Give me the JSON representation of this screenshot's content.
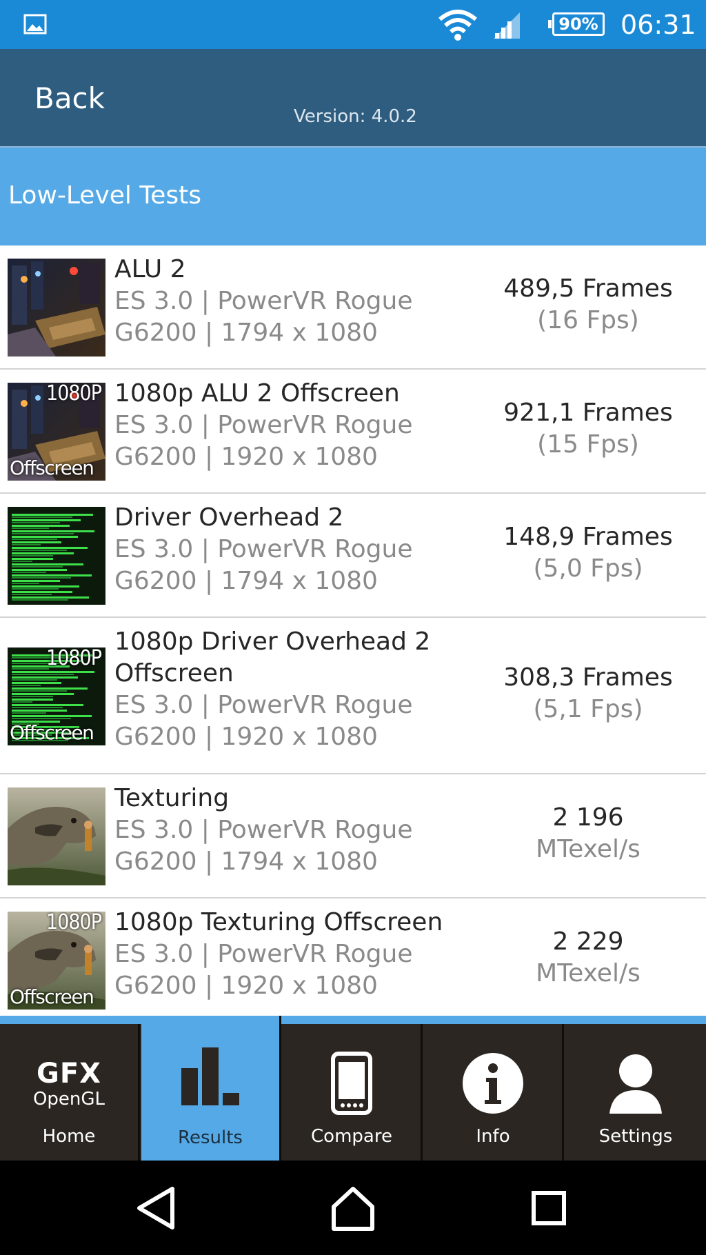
{
  "status_bar": {
    "battery": "90%",
    "time": "06:31",
    "icons": [
      "gallery-icon",
      "wifi-icon",
      "signal-icon",
      "battery-icon"
    ]
  },
  "header": {
    "back_label": "Back",
    "version": "Version: 4.0.2"
  },
  "section": {
    "title": "Low-Level Tests"
  },
  "results": [
    {
      "title": [
        "ALU 2"
      ],
      "subtitle": [
        "ES 3.0 | PowerVR Rogue",
        "G6200 | 1794 x 1080"
      ],
      "result_main": "489,5 Frames",
      "result_secondary": "(16 Fps)",
      "thumb": "alu-scene",
      "thumb_top": "",
      "thumb_bottom": ""
    },
    {
      "title": [
        "1080p ALU 2 Offscreen"
      ],
      "subtitle": [
        "ES 3.0 | PowerVR Rogue",
        "G6200 | 1920 x 1080"
      ],
      "result_main": "921,1 Frames",
      "result_secondary": "(15 Fps)",
      "thumb": "alu-scene",
      "thumb_top": "1080P",
      "thumb_bottom": "Offscreen"
    },
    {
      "title": [
        "Driver Overhead 2"
      ],
      "subtitle": [
        "ES 3.0 | PowerVR Rogue",
        "G6200 | 1794 x 1080"
      ],
      "result_main": "148,9 Frames",
      "result_secondary": "(5,0 Fps)",
      "thumb": "green-bars",
      "thumb_top": "",
      "thumb_bottom": ""
    },
    {
      "title": [
        "1080p Driver Overhead 2",
        "Offscreen"
      ],
      "subtitle": [
        "ES 3.0 | PowerVR Rogue",
        "G6200 | 1920 x 1080"
      ],
      "result_main": "308,3 Frames",
      "result_secondary": "(5,1 Fps)",
      "thumb": "green-bars",
      "thumb_top": "1080P",
      "thumb_bottom": "Offscreen"
    },
    {
      "title": [
        "Texturing"
      ],
      "subtitle": [
        "ES 3.0 | PowerVR Rogue",
        "G6200 | 1794 x 1080"
      ],
      "result_main": "2 196",
      "result_secondary": "MTexel/s",
      "thumb": "dinosaur",
      "thumb_top": "",
      "thumb_bottom": ""
    },
    {
      "title": [
        "1080p Texturing Offscreen"
      ],
      "subtitle": [
        "ES 3.0 | PowerVR Rogue",
        "G6200 | 1920 x 1080"
      ],
      "result_main": "2 229",
      "result_secondary": "MTexel/s",
      "thumb": "dinosaur",
      "thumb_top": "1080P",
      "thumb_bottom": "Offscreen"
    }
  ],
  "tabs": [
    {
      "label": "Home",
      "logo_big": "GFX",
      "logo_small": "OpenGL",
      "icon": "gfx-logo-icon",
      "active": false
    },
    {
      "label": "Results",
      "icon": "bar-chart-icon",
      "active": true
    },
    {
      "label": "Compare",
      "icon": "phone-icon",
      "active": false
    },
    {
      "label": "Info",
      "icon": "info-icon",
      "active": false
    },
    {
      "label": "Settings",
      "icon": "user-icon",
      "active": false
    }
  ],
  "nav": {
    "icons": [
      "back-triangle-icon",
      "home-outline-icon",
      "recents-square-icon"
    ]
  },
  "colors": {
    "status_bar": "#1a8ad6",
    "header": "#2e5d7f",
    "section": "#55a9e6",
    "tabbar": "#2b2621",
    "tab_active": "#55a9e6"
  }
}
